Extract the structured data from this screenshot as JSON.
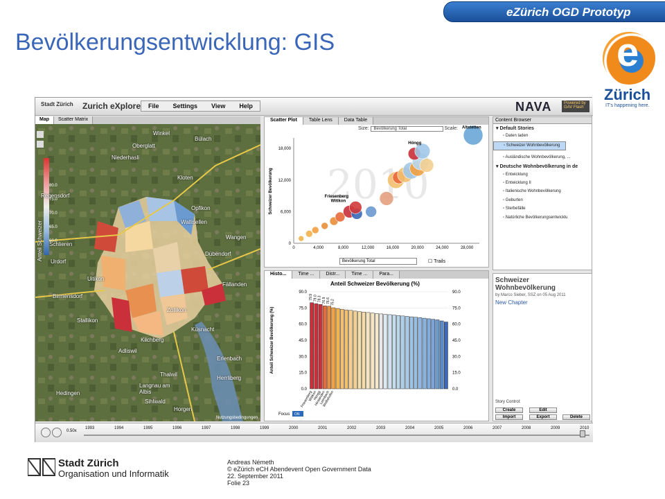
{
  "slide": {
    "title": "Bevölkerungsentwicklung: GIS",
    "banner": "eZürich OGD Prototyp",
    "logo_name": "Zürich",
    "logo_tagline": "IT's happening here."
  },
  "app": {
    "brand": "Stadt Zürich",
    "name": "Zurich eXplorer",
    "menus": [
      "File",
      "Settings",
      "View",
      "Help"
    ],
    "partner": "NAVA",
    "powered": "Powered by GAV Flash"
  },
  "map": {
    "tabs": [
      "Map",
      "Scatter Matrix"
    ],
    "legend_label": "Anteil Schweizer",
    "legend_values": [
      "80.0",
      "75.0",
      "70.0",
      "65.0",
      "60.0"
    ],
    "places": [
      "Winkel",
      "Oberglatt",
      "Bülach",
      "Niederhasli",
      "Kloten",
      "Regensdorf",
      "Opfikon",
      "Wallisellen",
      "Dübendorf",
      "Schlieren",
      "Urdorf",
      "Birmensdorf",
      "Zollikon",
      "Küsnacht",
      "Kilchberg",
      "Adliswil",
      "Thalwil",
      "Horgen",
      "Fällanden",
      "Wangen",
      "Uitikon",
      "Stallikon",
      "Langnau am Albis",
      "Erlenbach",
      "Herrliberg",
      "Sihlwald",
      "Hedingen"
    ],
    "attribution": "Nutzungsbedingungen"
  },
  "scatter": {
    "tabs": [
      "Scatter Plot",
      "Table Lens",
      "Data Table"
    ],
    "size_label": "Size:",
    "size_value": "Bevölkerung Total",
    "scale_label": "Scale:",
    "x_select": "Bevölkerung Total",
    "trails_label": "Trails",
    "ylabel": "Schweizer Bevölkerung",
    "year_watermark": "2010",
    "annotations": [
      "Altstetten",
      "Höngg",
      "Witikon",
      "Friesenberg"
    ]
  },
  "hist": {
    "tabs": [
      "Histo...",
      "Time ...",
      "Distr...",
      "Time ...",
      "Para..."
    ],
    "title": "Anteil Schweizer Bevölkerung (%)",
    "ylabel": "Anteil Schweizer Bevölkerung (%)",
    "focus_label": "Focus",
    "focus_value": "ON",
    "bar_labels": [
      "79.9",
      "79.0",
      "78.3",
      "76.9",
      "76.6",
      "75.2"
    ],
    "category_labels": [
      "Friesenberg",
      "Witikon",
      "Höngg",
      "Hirslanden",
      "Leimbach",
      "Wollishofen"
    ]
  },
  "browser": {
    "header": "Content Browser",
    "items": [
      {
        "label": "Default Stories",
        "group": true
      },
      {
        "label": "Daten laden"
      },
      {
        "label": "Schweizer Wohnbevölkerung",
        "selected": true
      },
      {
        "label": "Ausländische Wohnbevölkerung, ..."
      },
      {
        "label": "Deutsche Wohnbevölkerung in de",
        "group": true
      },
      {
        "label": "Entwicklung"
      },
      {
        "label": "Entwicklung II"
      },
      {
        "label": "Italienische Wohnbevölkerung"
      },
      {
        "label": "Geburten"
      },
      {
        "label": "Sterbefälle"
      },
      {
        "label": "Natürliche Bevölkerungsentwicklu"
      }
    ]
  },
  "story": {
    "title": "Schweizer Wohnbevölkerung",
    "byline": "by Marco Sieber, SSZ on 05 Aug 2011",
    "chapter": "New Chapter",
    "control_label": "Story Control:",
    "buttons": [
      "Create",
      "Edit",
      "Import",
      "Export",
      "Delete"
    ]
  },
  "timeline": {
    "speed": "0.50x",
    "years": [
      "1993",
      "1994",
      "1995",
      "1996",
      "1997",
      "1998",
      "1999",
      "2000",
      "2001",
      "2002",
      "2003",
      "2004",
      "2005",
      "2006",
      "2007",
      "2008",
      "2009",
      "2010"
    ]
  },
  "footer": {
    "org_name": "Stadt Zürich",
    "org_unit": "Organisation und Informatik",
    "author": "Andreas Németh",
    "event": "© eZürich eCH Abendevent Open Government Data",
    "date": "22. September 2011",
    "slide_no": "Folie 23"
  },
  "chart_data": [
    {
      "type": "scatter",
      "title": "",
      "xlabel": "Bevölkerung Total",
      "ylabel": "Schweizer Bevölkerung",
      "xlim": [
        0,
        30000
      ],
      "ylim": [
        0,
        20000
      ],
      "x_ticks": [
        "0",
        "4,000",
        "8,000",
        "12,000",
        "16,000",
        "20,000",
        "24,000",
        "28,000"
      ],
      "y_ticks": [
        "0",
        "6,000",
        "12,000",
        "18,000"
      ],
      "points": [
        {
          "x": 1200,
          "y": 900,
          "size": 4,
          "color": "#f3b24a"
        },
        {
          "x": 2500,
          "y": 1800,
          "size": 5,
          "color": "#f3b24a"
        },
        {
          "x": 3500,
          "y": 2500,
          "size": 5,
          "color": "#f3a040"
        },
        {
          "x": 5000,
          "y": 3300,
          "size": 5,
          "color": "#e9903a"
        },
        {
          "x": 6500,
          "y": 4200,
          "size": 6,
          "color": "#e9903a"
        },
        {
          "x": 7500,
          "y": 5000,
          "size": 7,
          "color": "#e86a3a"
        },
        {
          "x": 9000,
          "y": 6000,
          "size": 9,
          "color": "#c9303a"
        },
        {
          "x": 10200,
          "y": 5600,
          "size": 8,
          "color": "#3a6ab8"
        },
        {
          "x": 10000,
          "y": 6800,
          "size": 9,
          "color": "#d23a3a"
        },
        {
          "x": 12500,
          "y": 6000,
          "size": 8,
          "color": "#6a9ad0"
        },
        {
          "x": 15000,
          "y": 8500,
          "size": 10,
          "color": "#e5a080"
        },
        {
          "x": 16500,
          "y": 12000,
          "size": 12,
          "color": "#f3c070"
        },
        {
          "x": 17000,
          "y": 12500,
          "size": 9,
          "color": "#e86a3a"
        },
        {
          "x": 18000,
          "y": 13000,
          "size": 11,
          "color": "#f3c070"
        },
        {
          "x": 19000,
          "y": 13800,
          "size": 12,
          "color": "#a0c8e8"
        },
        {
          "x": 20000,
          "y": 14200,
          "size": 11,
          "color": "#f3a040"
        },
        {
          "x": 20500,
          "y": 15500,
          "size": 12,
          "color": "#b8d8f0"
        },
        {
          "x": 19500,
          "y": 17000,
          "size": 9,
          "color": "#c9303a"
        },
        {
          "x": 20800,
          "y": 17500,
          "size": 11,
          "color": "#a0c8e8"
        },
        {
          "x": 21500,
          "y": 14800,
          "size": 10,
          "color": "#f3d090"
        },
        {
          "x": 29000,
          "y": 20500,
          "size": 14,
          "color": "#6aa8d8"
        }
      ]
    },
    {
      "type": "bar",
      "title": "Anteil Schweizer Bevölkerung (%)",
      "ylabel": "Anteil Schweizer Bevölkerung (%)",
      "ylim": [
        0,
        90
      ],
      "y_ticks": [
        "0.0",
        "15.0",
        "30.0",
        "45.0",
        "60.0",
        "75.0",
        "90.0"
      ],
      "categories": [
        "Friesenberg",
        "Witikon",
        "Höngg",
        "Hirslanden",
        "Leimbach",
        "Wollishofen"
      ],
      "values": [
        79.9,
        79.0,
        78.3,
        76.9,
        76.6,
        75.2,
        74.5,
        73.8,
        73.2,
        72.8,
        72.1,
        71.6,
        71.2,
        70.8,
        70.3,
        69.8,
        69.5,
        69.1,
        68.8,
        68.4,
        68.0,
        67.6,
        67.2,
        66.8,
        66.4,
        66.0,
        65.5,
        65.0,
        64.5,
        64.0,
        63.0,
        62.0
      ],
      "colors": [
        "#c9303a",
        "#c9303a",
        "#c9303a",
        "#e86a3a",
        "#e9903a",
        "#f3a040",
        "#f3b24a",
        "#f3c070",
        "#f3c070",
        "#f3d090",
        "#f3d090",
        "#f5dca8",
        "#f5dca8",
        "#f5e4c0",
        "#f5e4c0",
        "#f5e8d0",
        "#e8e8e8",
        "#dde8f0",
        "#d0e2f0",
        "#c4dcee",
        "#b8d6ec",
        "#b0d0ea",
        "#a8cae8",
        "#a0c4e6",
        "#98bee4",
        "#90b8e2",
        "#88b2e0",
        "#80acde",
        "#78a6dc",
        "#6a9ad0",
        "#5a8ac8",
        "#3a6ab8"
      ]
    }
  ]
}
